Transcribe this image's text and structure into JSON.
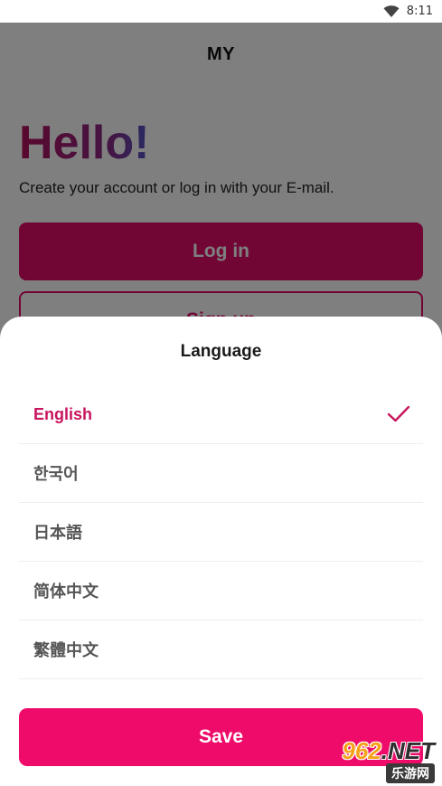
{
  "status_bar": {
    "time": "8:11",
    "wifi_icon": "wifi-icon"
  },
  "header": {
    "title": "MY"
  },
  "welcome": {
    "greeting": "Hello!",
    "subtitle": "Create your account or log in with your E-mail.",
    "login_label": "Log in",
    "signup_label": "Sign up"
  },
  "language_sheet": {
    "title": "Language",
    "selected_index": 0,
    "check_icon": "check-icon",
    "items": [
      {
        "label": "English"
      },
      {
        "label": "한국어"
      },
      {
        "label": "日本語"
      },
      {
        "label": "简体中文"
      },
      {
        "label": "繁體中文"
      }
    ],
    "save_label": "Save"
  },
  "watermark": {
    "brand": "962",
    "suffix": ".NET",
    "subtitle": "乐游网"
  },
  "colors": {
    "accent": "#e20c6b",
    "save_button": "#ee0b6a",
    "selected_text": "#c8145e",
    "overlay": "rgba(0,0,0,0.5)"
  }
}
